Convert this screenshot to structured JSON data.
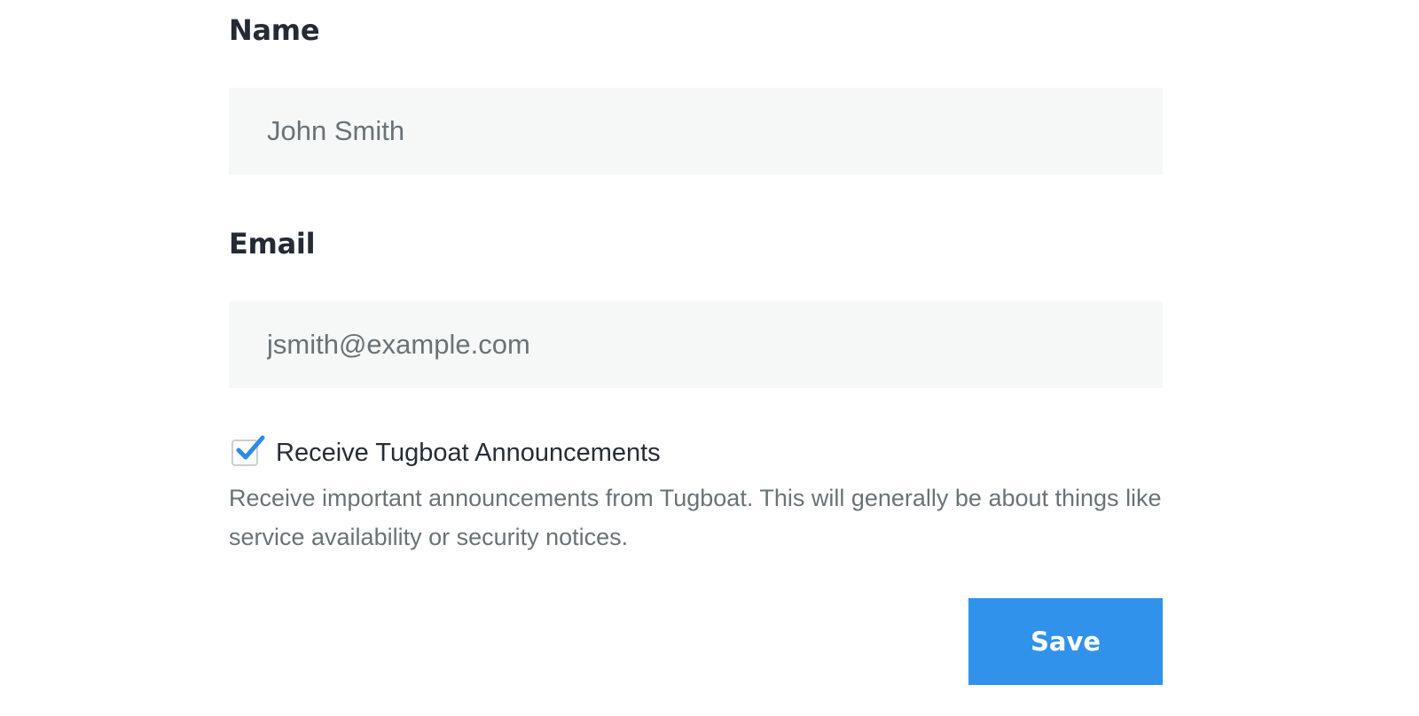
{
  "form": {
    "name_label": "Name",
    "name_value": "John Smith",
    "email_label": "Email",
    "email_value": "jsmith@example.com",
    "announcements": {
      "checked": true,
      "label": "Receive Tugboat Announcements",
      "description": "Receive important announcements from Tugboat. This will generally be about things like service availability or security notices."
    },
    "save_label": "Save"
  },
  "colors": {
    "accent": "#3192ec",
    "field_background": "#f6f8f8",
    "heading_text": "#242b35",
    "muted_text": "#697377"
  },
  "icons": {
    "checkbox": "checkmark-icon"
  }
}
